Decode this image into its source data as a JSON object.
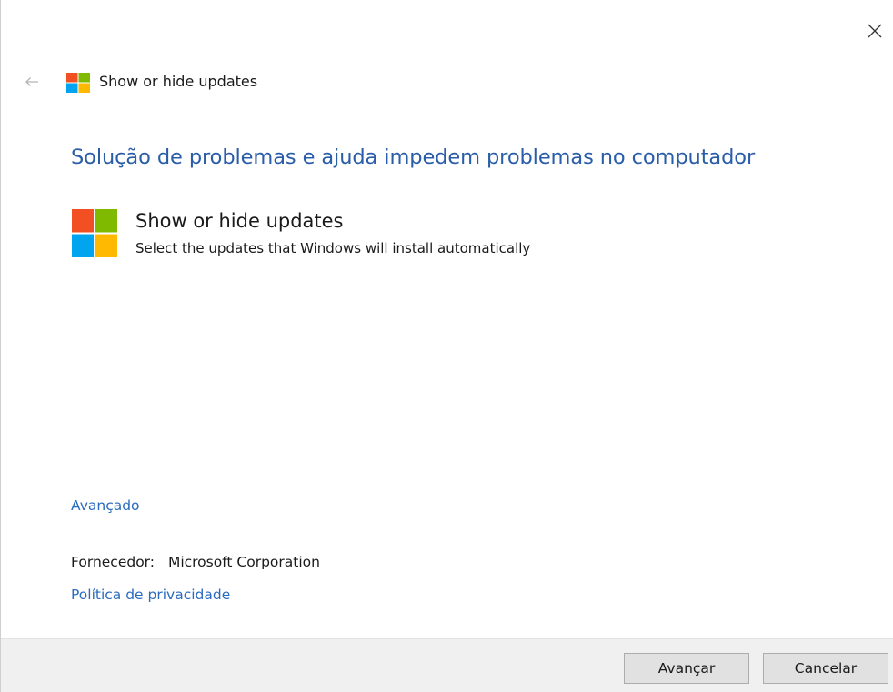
{
  "window": {
    "close_icon": "close-icon",
    "back_icon": "back-arrow-icon",
    "title": "Show or hide updates"
  },
  "main": {
    "heading": "Solução de problemas e ajuda impedem problemas no computador",
    "item": {
      "title": "Show or hide updates",
      "description": "Select the updates that Windows will install automatically",
      "icon": "windows-logo-icon"
    },
    "advanced_link": "Avançado",
    "publisher_label": "Fornecedor:",
    "publisher_value": "Microsoft Corporation",
    "privacy_link": "Política de privacidade"
  },
  "footer": {
    "next_label": "Avançar",
    "cancel_label": "Cancelar"
  },
  "colors": {
    "heading": "#2a5da8",
    "link": "#2a6bbf",
    "logo_red": "#f25022",
    "logo_green": "#7fba00",
    "logo_blue": "#00a4ef",
    "logo_yellow": "#ffb900"
  }
}
